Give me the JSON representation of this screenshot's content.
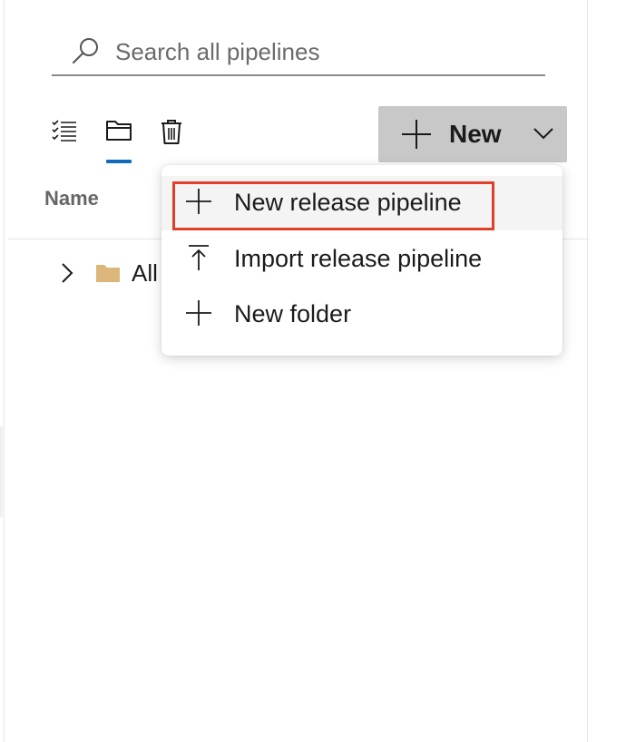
{
  "search": {
    "placeholder": "Search all pipelines"
  },
  "toolbar": {
    "views": [
      {
        "icon": "list-view-icon"
      },
      {
        "icon": "folder-view-icon",
        "selected": true
      },
      {
        "icon": "trash-icon"
      }
    ],
    "new_button": {
      "label": "New",
      "icon": "plus-icon",
      "dropdown_icon": "chevron-down-icon"
    }
  },
  "table": {
    "name_header": "Name"
  },
  "tree": {
    "items": [
      {
        "label": "All",
        "icon": "folder-icon",
        "expander": "chevron-right-icon"
      }
    ]
  },
  "menu": {
    "items": [
      {
        "label": "New release pipeline",
        "icon": "plus-icon",
        "highlighted": true
      },
      {
        "label": "Import release pipeline",
        "icon": "import-icon"
      },
      {
        "label": "New folder",
        "icon": "plus-icon"
      }
    ]
  },
  "colors": {
    "accent": "#0f6cbd",
    "highlight_border": "#e0402a",
    "button_bg": "#c8c8c8",
    "folder": "#dcb67a"
  }
}
